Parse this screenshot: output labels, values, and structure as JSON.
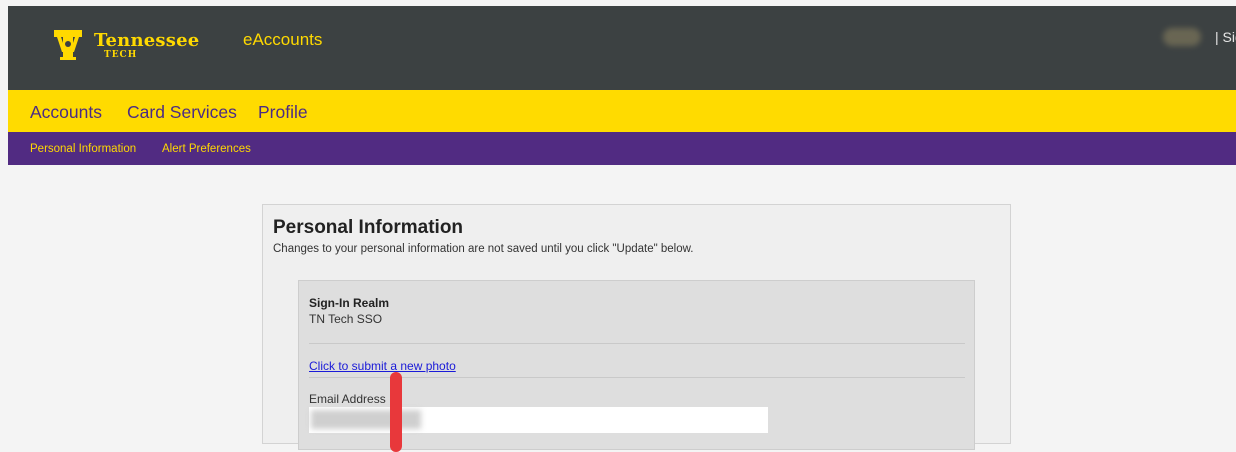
{
  "header": {
    "logo_word": "Tennessee",
    "logo_sub": "TECH",
    "app_title": "eAccounts",
    "user_menu_text": "| Sig",
    "colors": {
      "bar": "#3c4142",
      "gold": "#ffd900"
    }
  },
  "main_nav": {
    "items": [
      "Accounts",
      "Card Services",
      "Profile"
    ],
    "colors": {
      "background": "#ffdb00",
      "text": "#4b2c84"
    }
  },
  "sub_nav": {
    "items": [
      "Personal Information",
      "Alert Preferences"
    ],
    "colors": {
      "background": "#512b82",
      "text": "#ffd900"
    }
  },
  "panel": {
    "title": "Personal Information",
    "subtitle": "Changes to your personal information are not saved until you click \"Update\" below.",
    "sign_in_realm_label": "Sign-In Realm",
    "sign_in_realm_value": "TN Tech SSO",
    "photo_link": "Click to submit a new photo",
    "email_label": "Email Address",
    "email_value": ""
  },
  "annotation": {
    "color": "#e8383b"
  }
}
